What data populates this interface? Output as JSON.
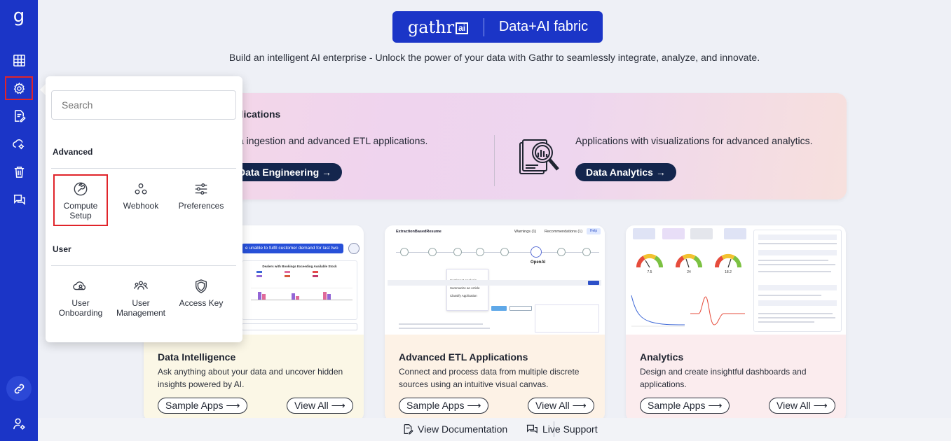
{
  "sidebar": {
    "logo": "g",
    "items": [
      "dashboard-icon",
      "settings-icon",
      "document-edit-icon",
      "cloud-settings-icon",
      "trash-icon",
      "chat-icon"
    ],
    "bottom": [
      "link-icon",
      "user-settings-icon"
    ]
  },
  "header": {
    "brand_logo": "gathr",
    "brand_logo_suffix": "ai",
    "brand_tagline": "Data+AI fabric",
    "subtitle": "Build an intelligent AI enterprise - Unlock the power of your data with Gathr to seamlessly integrate, analyze, and innovate."
  },
  "hero": {
    "title_fragment": "plications",
    "left_text": "a ingestion and advanced ETL applications.",
    "left_button": "Data Engineering →",
    "right_text": "Applications with visualizations for advanced analytics.",
    "right_button": "Data Analytics →"
  },
  "cards": [
    {
      "title": "Data Intelligence",
      "description": "Ask anything about your data and uncover hidden insights powered by AI.",
      "sample_label": "Sample Apps ⟶",
      "view_label": "View All ⟶",
      "preview": {
        "question": "e unable to fulfil customer demand for last two moths?",
        "chart_title": "Dealers with Bookings Exceeding Available Stock"
      }
    },
    {
      "title": "Advanced ETL Applications",
      "description": "Connect and process data from multiple discrete sources using an intuitive visual canvas.",
      "sample_label": "Sample Apps ⟶",
      "view_label": "View All ⟶",
      "preview": {
        "app_name": "ExtractionBasedResume",
        "warnings": "Warnings (1)",
        "recommendations": "Recommendations (1)",
        "help": "Help",
        "menu": [
          "Sentiment Analysis",
          "Summarize an Article",
          "Classify Application"
        ],
        "openai": "OpenAI"
      }
    },
    {
      "title": "Analytics",
      "description": "Design and create insightful dashboards and applications.",
      "sample_label": "Sample Apps ⟶",
      "view_label": "View All ⟶",
      "preview": {
        "gauges": [
          "7.5",
          "24",
          "18.2"
        ]
      }
    }
  ],
  "footer": {
    "docs_label": "View Documentation",
    "support_label": "Live Support"
  },
  "popover": {
    "search_placeholder": "Search",
    "sections": [
      {
        "title": "Advanced",
        "items": [
          {
            "label": "Compute Setup",
            "icon": "compute-setup-icon",
            "selected": true
          },
          {
            "label": "Webhook",
            "icon": "webhook-icon"
          },
          {
            "label": "Preferences",
            "icon": "sliders-icon"
          }
        ]
      },
      {
        "title": "User",
        "items": [
          {
            "label": "User Onboarding",
            "icon": "user-onboarding-icon"
          },
          {
            "label": "User Management",
            "icon": "user-management-icon"
          },
          {
            "label": "Access Key",
            "icon": "shield-icon"
          }
        ]
      }
    ]
  },
  "colors": {
    "sidebar": "#1b35c7",
    "dark_button": "#14264d",
    "highlight": "#e0242a"
  }
}
